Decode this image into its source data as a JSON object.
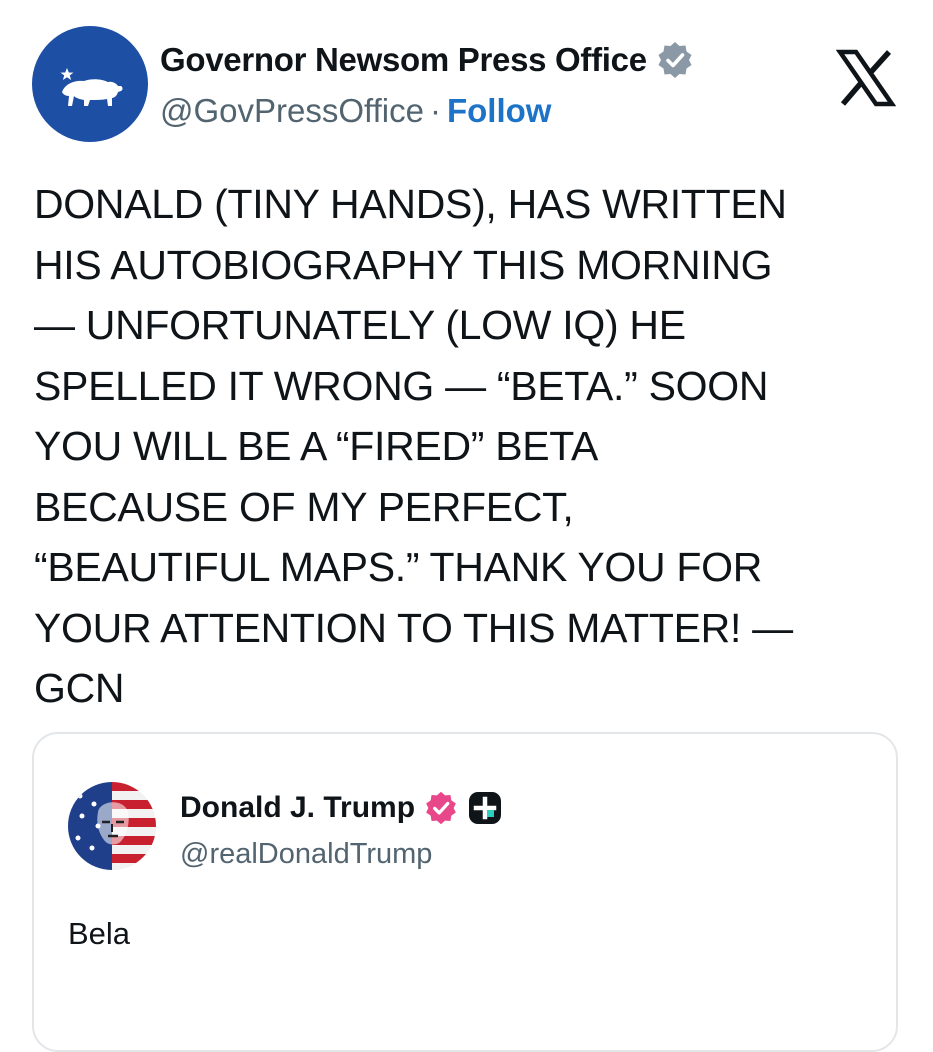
{
  "author": {
    "name": "Governor Newsom Press Office",
    "handle": "@GovPressOffice",
    "separator": "·",
    "follow_label": "Follow",
    "avatar": "california-bear-flag-logo",
    "verified_badge": "gray-verified-checkmark-icon"
  },
  "header": {
    "platform_icon": "x-logo-icon"
  },
  "post": {
    "lines": [
      "DONALD (TINY HANDS), HAS WRITTEN",
      "HIS AUTOBIOGRAPHY THIS MORNING",
      "— UNFORTUNATELY (LOW IQ) HE",
      "SPELLED IT WRONG — “BETA.” SOON",
      "YOU WILL BE A “FIRED” BETA",
      "BECAUSE OF MY PERFECT,",
      "“BEAUTIFUL MAPS.” THANK YOU FOR",
      "YOUR ATTENTION TO THIS MATTER! —",
      "GCN"
    ]
  },
  "quoted_post": {
    "name": "Donald J. Trump",
    "handle": "@realDonaldTrump",
    "text": "Bela",
    "verified_badge": "pink-verified-checkmark-icon",
    "extra_badge": "truth-social-plus-icon",
    "avatar": "flag-portrait-avatar"
  },
  "colors": {
    "text": "#0f1419",
    "secondary_text": "#536471",
    "follow": "#1d73c8",
    "avatar_blue": "#1d4fa5",
    "verified_gray": "#8b98a5",
    "verified_pink": "#e8488a",
    "card_border": "#e3e6e9"
  }
}
